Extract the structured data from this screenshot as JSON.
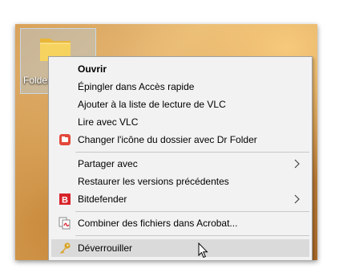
{
  "desktop": {
    "folder_label": "Folder"
  },
  "context_menu": {
    "items": [
      {
        "label": "Ouvrir",
        "bold": true
      },
      {
        "label": "Épingler dans Accès rapide"
      },
      {
        "label": "Ajouter à la liste de lecture de VLC"
      },
      {
        "label": "Lire avec VLC"
      },
      {
        "label": "Changer l'icône du dossier avec Dr Folder",
        "icon": "dr-folder-icon"
      },
      {
        "label": "Partager avec",
        "submenu": true
      },
      {
        "label": "Restaurer les versions précédentes"
      },
      {
        "label": "Bitdefender",
        "icon": "bitdefender-icon",
        "submenu": true
      },
      {
        "label": "Combiner des fichiers dans Acrobat...",
        "icon": "acrobat-combine-icon"
      },
      {
        "label": "Déverrouiller",
        "icon": "key-icon",
        "highlighted": true
      }
    ],
    "icons": {
      "bitdefender_letter": "B"
    }
  },
  "colors": {
    "menu_bg": "#f2f2f2",
    "hover_bg": "#dadada",
    "bitdefender_red": "#d8232a",
    "drfolder_red": "#e2493b",
    "key_gold": "#d9a429"
  }
}
